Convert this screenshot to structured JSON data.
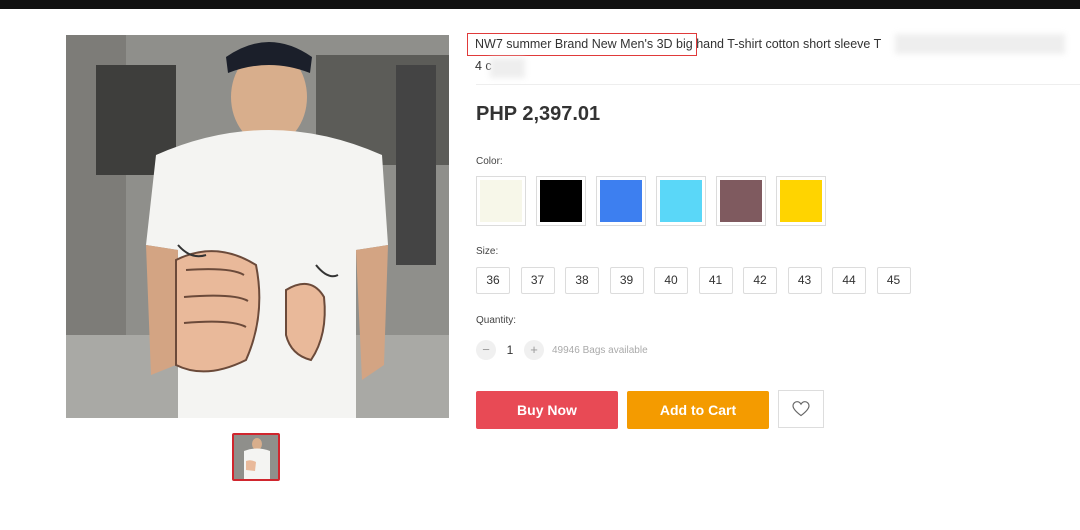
{
  "product": {
    "title_line1": "NW7 summer Brand New Men's 3D big hand T-shirt cotton short sleeve T",
    "title_line2": "4 c",
    "price": "PHP 2,397.01"
  },
  "color": {
    "label": "Color:",
    "options": [
      "#f7f7e9",
      "#000000",
      "#3d7ff0",
      "#5ad7f8",
      "#7f5a5f",
      "#ffd400"
    ]
  },
  "size": {
    "label": "Size:",
    "options": [
      "36",
      "37",
      "38",
      "39",
      "40",
      "41",
      "42",
      "43",
      "44",
      "45"
    ]
  },
  "quantity": {
    "label": "Quantity:",
    "minus": "−",
    "value": "1",
    "plus": "+",
    "available": "49946 Bags available"
  },
  "actions": {
    "buy_now": "Buy Now",
    "add_to_cart": "Add to Cart"
  },
  "accent": {
    "buy": "#e84a55",
    "cart": "#f49b00",
    "highlight": "#e03a3a"
  }
}
